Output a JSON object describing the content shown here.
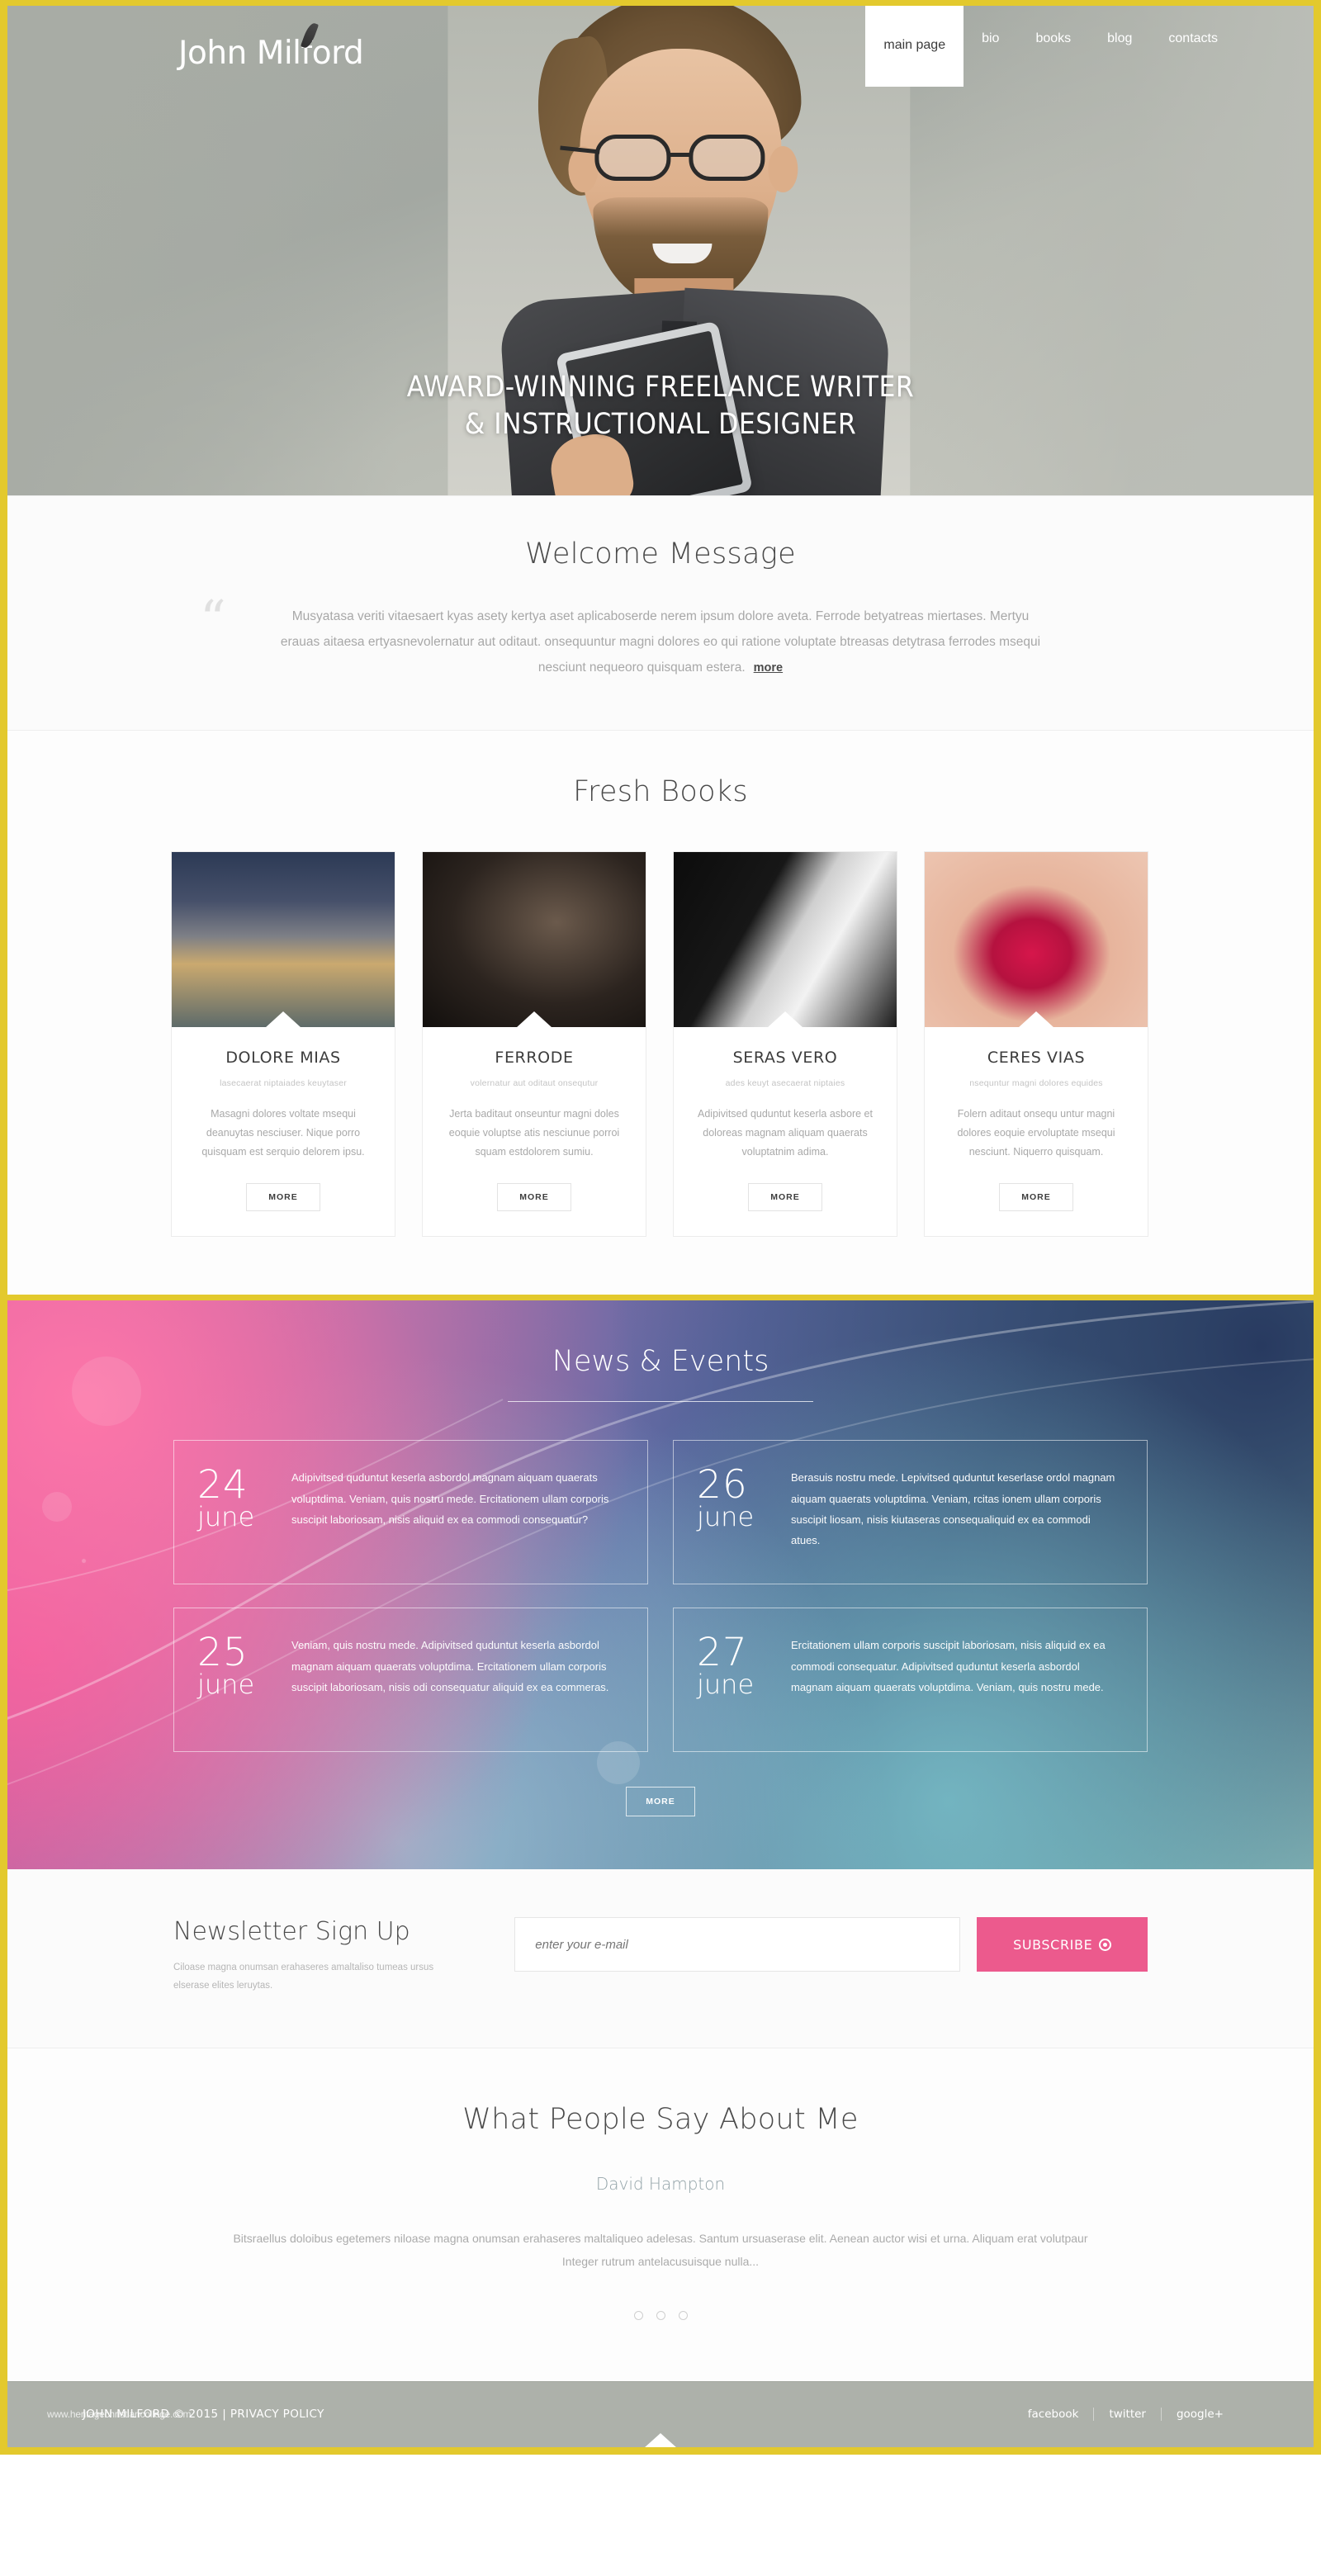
{
  "brand": {
    "name": "John Milford",
    "accent": "#e3c92d",
    "pink": "#ec5a8d"
  },
  "nav": {
    "items": [
      {
        "label": "main page",
        "active": true
      },
      {
        "label": "bio",
        "active": false
      },
      {
        "label": "books",
        "active": false
      },
      {
        "label": "blog",
        "active": false
      },
      {
        "label": "contacts",
        "active": false
      }
    ]
  },
  "hero": {
    "tagline_line1": "AWARD-WINNING FREELANCE WRITER",
    "tagline_line2": "& INSTRUCTIONAL DESIGNER"
  },
  "welcome": {
    "title": "Welcome Message",
    "quote_glyph": "“",
    "body": "Musyatasa veriti vitaesaert kyas asety kertya aset aplicaboserde nerem ipsum dolore aveta. Ferrode betyatreas miertases. Mertyu erauas aitaesa ertyasnevolernatur aut oditaut. onsequuntur magni dolores eo qui ratione voluptate btreasas detytrasa ferrodes msequi nesciunt nequeoro quisquam estera.",
    "more_label": "more"
  },
  "books": {
    "title": "Fresh Books",
    "more_label": "MORE",
    "items": [
      {
        "title": "DOLORE MIAS",
        "subtitle": "lasecaerat niptaiades keuytaser",
        "desc": "Masagni dolores voltate msequi deanuytas nesciuser. Nique porro quisquam est serquio delorem ipsu.",
        "image": "stormy-road-photo"
      },
      {
        "title": "FERRODE",
        "subtitle": "volernatur aut oditaut onsequtur",
        "desc": "Jerta baditaut onseuntur magni doles eoquie voluptse atis nesciunue porroi squam estdolorem sumiu.",
        "image": "woman-studded-headpiece-photo"
      },
      {
        "title": "SERAS VERO",
        "subtitle": "ades keuyt asecaerat niptaies",
        "desc": "Adipivitsed quduntut keserla asbore et doloreas magnam aliquam quaerats voluptatnim adima.",
        "image": "white-sculpture-photo"
      },
      {
        "title": "CERES VIAS",
        "subtitle": "nsequntur magni dolores equides",
        "desc": "Folern aditaut onsequ untur magni dolores eoquie ervoluptate msequi nesciunt. Niquerro quisquam.",
        "image": "red-lips-photo"
      }
    ]
  },
  "news": {
    "title": "News & Events",
    "more_label": "MORE",
    "items": [
      {
        "day": "24",
        "month": "june",
        "text": "Adipivitsed quduntut keserla asbordol magnam aiquam quaerats voluptdima. Veniam, quis nostru mede. Ercitationem ullam corporis suscipit laboriosam, nisis aliquid ex ea commodi consequatur?"
      },
      {
        "day": "26",
        "month": "june",
        "text": "Berasuis nostru mede. Lepivitsed quduntut keserlase ordol magnam aiquam quaerats voluptdima. Veniam, rcitas ionem ullam corporis suscipit liosam, nisis kiutaseras consequaliquid ex ea commodi atues."
      },
      {
        "day": "25",
        "month": "june",
        "text": "Veniam, quis nostru mede. Adipivitsed quduntut keserla asbordol magnam aiquam quaerats voluptdima. Ercitationem ullam corporis suscipit laboriosam, nisis odi consequatur aliquid ex ea commeras."
      },
      {
        "day": "27",
        "month": "june",
        "text": "Ercitationem ullam corporis suscipit laboriosam, nisis aliquid ex ea commodi consequatur. Adipivitsed quduntut keserla asbordol magnam aiquam quaerats voluptdima. Veniam, quis nostru mede."
      }
    ]
  },
  "newsletter": {
    "title": "Newsletter Sign Up",
    "subtitle": "Ciloase magna onumsan erahaseres amaltaliso tumeas ursus elserase elites leruytas.",
    "input_value": "",
    "input_placeholder": "enter your e-mail",
    "button_label": "SUBSCRIBE"
  },
  "testimonials": {
    "title": "What People Say About Me",
    "author": "David Hampton",
    "text": "Bitsraellus doloibus egetemers niloase magna onumsan erahaseres maltaliqueo adelesas. Santum ursuaserase elit. Aenean auctor wisi et urna. Aliquam erat volutpaur Integer rutrum antelacusuisque nulla...",
    "dots": 3
  },
  "footer": {
    "copyright": "JOHN MILFORD © 2015",
    "separator": "|",
    "privacy_label": "PRIVACY POLICY",
    "watermark": "www.heritagechristiancollege.com",
    "social": [
      {
        "label": "facebook"
      },
      {
        "label": "twitter"
      },
      {
        "label": "google+"
      }
    ]
  }
}
